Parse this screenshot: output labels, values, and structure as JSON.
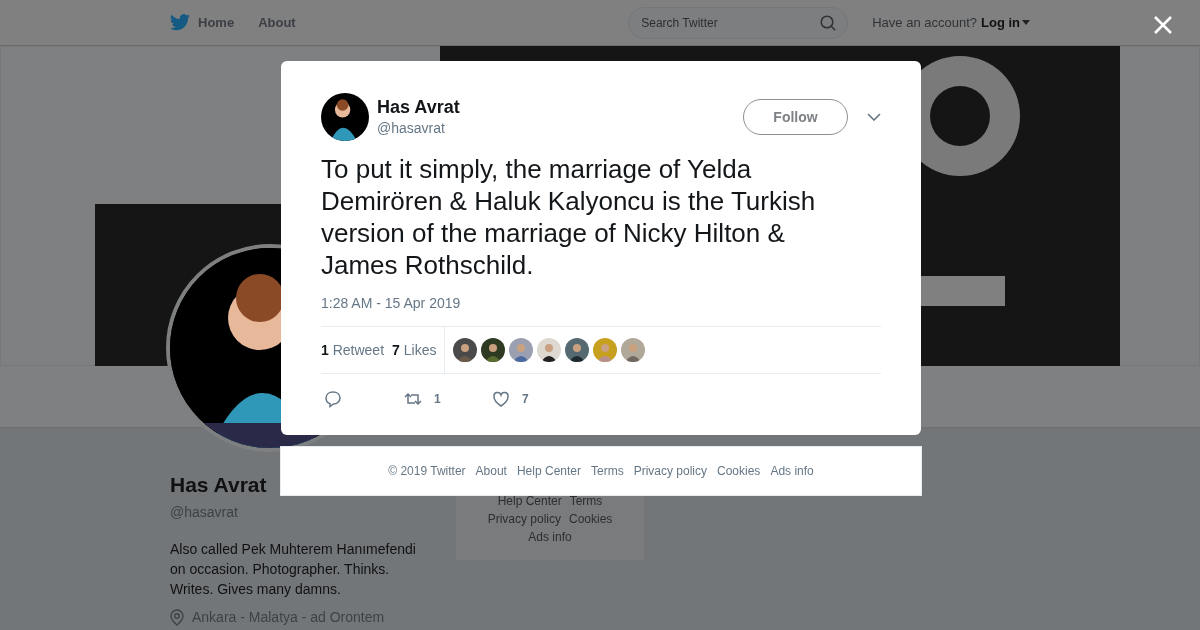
{
  "nav": {
    "items": [
      "Home",
      "About"
    ],
    "search": {
      "placeholder": "Search Twitter"
    },
    "account_prompt": "Have an account?",
    "login": "Log in"
  },
  "profile": {
    "name": "Has Avrat",
    "handle": "@hasavrat",
    "bio": "Also called Pek Muhterem Hanımefendi on occasion. Photographer. Thinks. Writes. Gives many damns.",
    "location": "Ankara - Malatya - ad Orontem"
  },
  "side_footer": {
    "rows": [
      [
        "Help Center",
        "Terms"
      ],
      [
        "Privacy policy",
        "Cookies"
      ],
      [
        "Ads info"
      ]
    ]
  },
  "tweet": {
    "author": {
      "name": "Has Avrat",
      "handle": "@hasavrat"
    },
    "follow": "Follow",
    "text": "To put it simply, the marriage of Yelda Demirören & Haluk Kalyoncu is the Turkish version of the marriage of Nicky Hilton & James Rothschild.",
    "timestamp": "1:28 AM - 15 Apr 2019",
    "stats": [
      {
        "count": "1",
        "label": "Retweet"
      },
      {
        "count": "7",
        "label": "Likes"
      }
    ],
    "actions": [
      {
        "kind": "reply"
      },
      {
        "kind": "retweet",
        "count": "1"
      },
      {
        "kind": "like",
        "count": "7"
      }
    ]
  },
  "footer": {
    "links": [
      "© 2019 Twitter",
      "About",
      "Help Center",
      "Terms",
      "Privacy policy",
      "Cookies",
      "Ads info"
    ]
  }
}
